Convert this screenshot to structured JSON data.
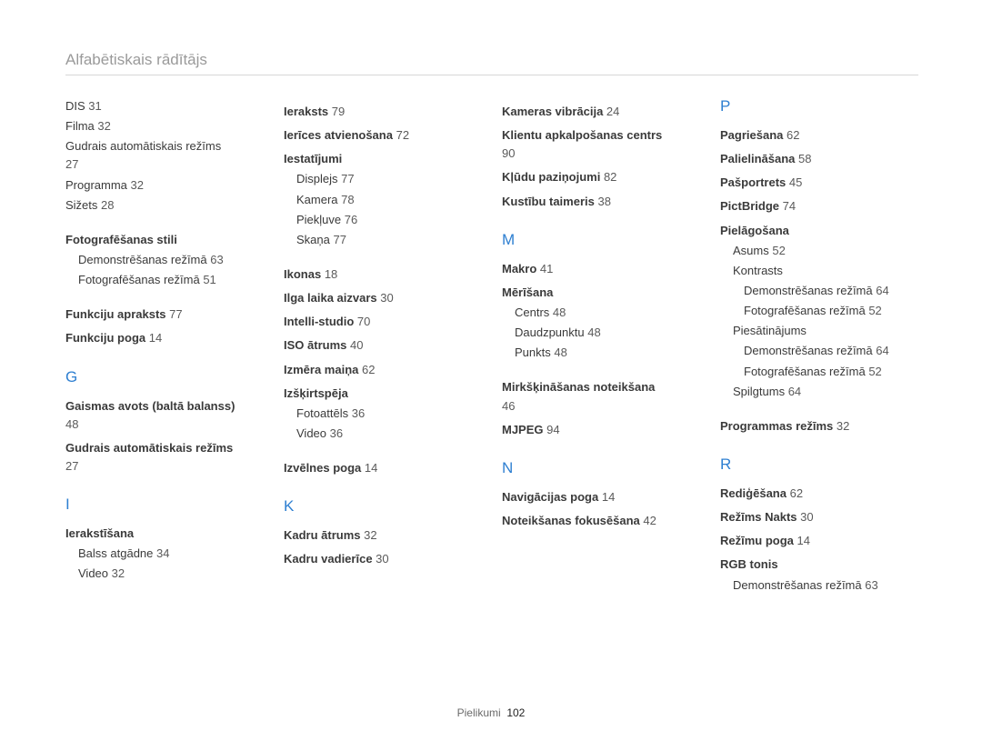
{
  "header": "Alfabētiskais rādītājs",
  "footer": {
    "label": "Pielikumi",
    "page": "102"
  },
  "columns": [
    {
      "items": [
        {
          "t": "entry",
          "text": "DIS",
          "page": "31"
        },
        {
          "t": "entry",
          "text": "Filma",
          "page": "32"
        },
        {
          "t": "entry",
          "text": "Gudrais automātiskais režīms",
          "page": "27",
          "wrap": true
        },
        {
          "t": "entry",
          "text": "Programma",
          "page": "32"
        },
        {
          "t": "entry",
          "text": "Sižets",
          "page": "28"
        },
        {
          "t": "gap"
        },
        {
          "t": "bold",
          "text": "Fotografēšanas stili"
        },
        {
          "t": "sub",
          "text": "Demonstrēšanas režīmā",
          "page": "63"
        },
        {
          "t": "sub",
          "text": "Fotografēšanas režīmā",
          "page": "51"
        },
        {
          "t": "gap"
        },
        {
          "t": "bold",
          "text": "Funkciju apraksts",
          "page": "77"
        },
        {
          "t": "bold",
          "text": "Funkciju poga",
          "page": "14"
        },
        {
          "t": "letter",
          "text": "G"
        },
        {
          "t": "bold",
          "text": "Gaismas avots (baltā balanss)",
          "page": "48",
          "wrap": true
        },
        {
          "t": "bold",
          "text": "Gudrais automātiskais režīms",
          "page": "27",
          "wrap": true
        },
        {
          "t": "letter",
          "text": "I"
        },
        {
          "t": "bold",
          "text": "Ierakstīšana"
        },
        {
          "t": "sub",
          "text": "Balss atgādne",
          "page": "34"
        },
        {
          "t": "sub",
          "text": "Video",
          "page": "32"
        }
      ]
    },
    {
      "items": [
        {
          "t": "bold",
          "text": "Ieraksts",
          "page": "79"
        },
        {
          "t": "bold",
          "text": "Ierīces atvienošana",
          "page": "72"
        },
        {
          "t": "bold",
          "text": "Iestatījumi"
        },
        {
          "t": "sub",
          "text": "Displejs",
          "page": "77"
        },
        {
          "t": "sub",
          "text": "Kamera",
          "page": "78"
        },
        {
          "t": "sub",
          "text": "Piekļuve",
          "page": "76"
        },
        {
          "t": "sub",
          "text": "Skaņa",
          "page": "77"
        },
        {
          "t": "gap"
        },
        {
          "t": "bold",
          "text": "Ikonas",
          "page": "18"
        },
        {
          "t": "bold",
          "text": "Ilga laika aizvars",
          "page": "30"
        },
        {
          "t": "bold",
          "text": "Intelli-studio",
          "page": "70"
        },
        {
          "t": "bold",
          "text": "ISO ātrums",
          "page": "40"
        },
        {
          "t": "bold",
          "text": "Izmēra maiņa",
          "page": "62"
        },
        {
          "t": "bold",
          "text": "Izšķirtspēja"
        },
        {
          "t": "sub",
          "text": "Fotoattēls",
          "page": "36"
        },
        {
          "t": "sub",
          "text": "Video",
          "page": "36"
        },
        {
          "t": "gap"
        },
        {
          "t": "bold",
          "text": "Izvēlnes poga",
          "page": "14"
        },
        {
          "t": "letter",
          "text": "K"
        },
        {
          "t": "bold",
          "text": "Kadru ātrums",
          "page": "32"
        },
        {
          "t": "bold",
          "text": "Kadru vadierīce",
          "page": "30"
        }
      ]
    },
    {
      "items": [
        {
          "t": "bold",
          "text": "Kameras vibrācija",
          "page": "24"
        },
        {
          "t": "bold",
          "text": "Klientu apkalpošanas centrs",
          "page": "90",
          "wrap": true
        },
        {
          "t": "bold",
          "text": "Kļūdu paziņojumi",
          "page": "82"
        },
        {
          "t": "bold",
          "text": "Kustību taimeris",
          "page": "38"
        },
        {
          "t": "letter",
          "text": "M"
        },
        {
          "t": "bold",
          "text": "Makro",
          "page": "41"
        },
        {
          "t": "bold",
          "text": "Mērīšana"
        },
        {
          "t": "sub",
          "text": "Centrs",
          "page": "48"
        },
        {
          "t": "sub",
          "text": "Daudzpunktu",
          "page": "48"
        },
        {
          "t": "sub",
          "text": "Punkts",
          "page": "48"
        },
        {
          "t": "gap"
        },
        {
          "t": "bold",
          "text": "Mirkšķināšanas noteikšana",
          "page": "46",
          "wrap": true
        },
        {
          "t": "bold",
          "text": "MJPEG",
          "page": "94"
        },
        {
          "t": "letter",
          "text": "N"
        },
        {
          "t": "bold",
          "text": "Navigācijas poga",
          "page": "14"
        },
        {
          "t": "bold",
          "text": "Noteikšanas fokusēšana",
          "page": "42"
        }
      ]
    },
    {
      "items": [
        {
          "t": "letter",
          "text": "P",
          "notop": true
        },
        {
          "t": "bold",
          "text": "Pagriešana",
          "page": "62"
        },
        {
          "t": "bold",
          "text": "Palielināšana",
          "page": "58"
        },
        {
          "t": "bold",
          "text": "Pašportrets",
          "page": "45"
        },
        {
          "t": "bold",
          "text": "PictBridge",
          "page": "74"
        },
        {
          "t": "bold",
          "text": "Pielāgošana"
        },
        {
          "t": "sub",
          "text": "Asums",
          "page": "52"
        },
        {
          "t": "sub",
          "text": "Kontrasts"
        },
        {
          "t": "sub2",
          "text": "Demonstrēšanas režīmā",
          "page": "64"
        },
        {
          "t": "sub2",
          "text": "Fotografēšanas režīmā",
          "page": "52"
        },
        {
          "t": "sub",
          "text": "Piesātinājums"
        },
        {
          "t": "sub2",
          "text": "Demonstrēšanas režīmā",
          "page": "64"
        },
        {
          "t": "sub2",
          "text": "Fotografēšanas režīmā",
          "page": "52"
        },
        {
          "t": "sub",
          "text": "Spilgtums",
          "page": "64"
        },
        {
          "t": "gap"
        },
        {
          "t": "bold",
          "text": "Programmas režīms",
          "page": "32"
        },
        {
          "t": "letter",
          "text": "R"
        },
        {
          "t": "bold",
          "text": "Rediģēšana",
          "page": "62"
        },
        {
          "t": "bold",
          "text": "Režīms Nakts",
          "page": "30"
        },
        {
          "t": "bold",
          "text": "Režīmu poga",
          "page": "14"
        },
        {
          "t": "bold",
          "text": "RGB tonis"
        },
        {
          "t": "sub",
          "text": "Demonstrēšanas režīmā",
          "page": "63"
        }
      ]
    }
  ]
}
